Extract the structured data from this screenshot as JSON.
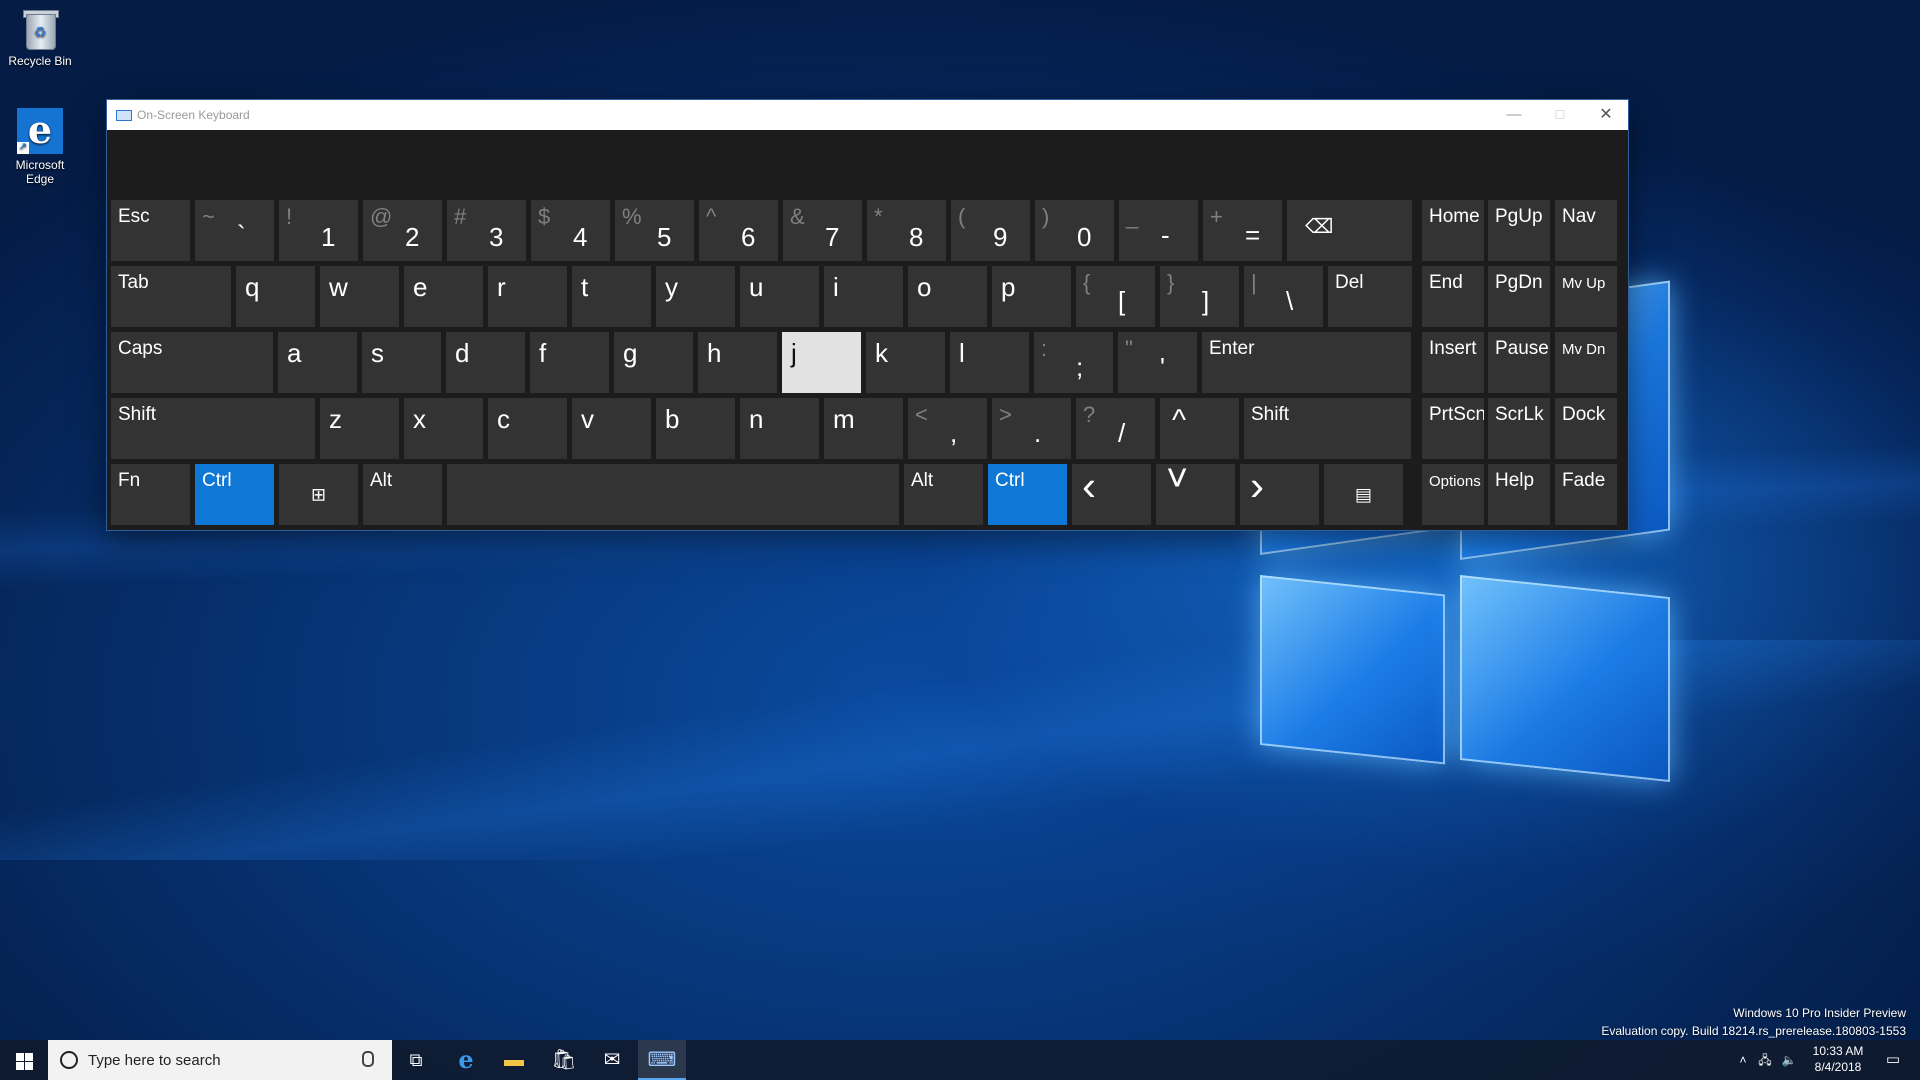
{
  "desktop": {
    "icons": [
      {
        "label": "Recycle Bin"
      },
      {
        "label": "Microsoft Edge"
      }
    ],
    "watermark": {
      "line1": "Windows 10 Pro Insider Preview",
      "line2": "Evaluation copy. Build 18214.rs_prerelease.180803-1553"
    }
  },
  "osk": {
    "title": "On-Screen Keyboard",
    "pressed_key": "j",
    "active_modifiers": [
      "Ctrl"
    ],
    "rows": [
      [
        {
          "label": "Esc"
        },
        {
          "secondary": "~",
          "primary": "`"
        },
        {
          "secondary": "!",
          "primary": "1"
        },
        {
          "secondary": "@",
          "primary": "2"
        },
        {
          "secondary": "#",
          "primary": "3"
        },
        {
          "secondary": "$",
          "primary": "4"
        },
        {
          "secondary": "%",
          "primary": "5"
        },
        {
          "secondary": "^",
          "primary": "6"
        },
        {
          "secondary": "&",
          "primary": "7"
        },
        {
          "secondary": "*",
          "primary": "8"
        },
        {
          "secondary": "(",
          "primary": "9"
        },
        {
          "secondary": ")",
          "primary": "0"
        },
        {
          "secondary": "_",
          "primary": "-"
        },
        {
          "secondary": "+",
          "primary": "="
        },
        {
          "icon": "backspace-icon",
          "glyph": "⌫"
        },
        {
          "label": "Home"
        },
        {
          "label": "PgUp"
        },
        {
          "label": "Nav"
        }
      ],
      [
        {
          "label": "Tab"
        },
        {
          "primary": "q"
        },
        {
          "primary": "w"
        },
        {
          "primary": "e"
        },
        {
          "primary": "r"
        },
        {
          "primary": "t"
        },
        {
          "primary": "y"
        },
        {
          "primary": "u"
        },
        {
          "primary": "i"
        },
        {
          "primary": "o"
        },
        {
          "primary": "p"
        },
        {
          "secondary": "{",
          "primary": "["
        },
        {
          "secondary": "}",
          "primary": "]"
        },
        {
          "secondary": "|",
          "primary": "\\"
        },
        {
          "label": "Del"
        },
        {
          "label": "End"
        },
        {
          "label": "PgDn"
        },
        {
          "label": "Mv Up"
        }
      ],
      [
        {
          "label": "Caps"
        },
        {
          "primary": "a"
        },
        {
          "primary": "s"
        },
        {
          "primary": "d"
        },
        {
          "primary": "f"
        },
        {
          "primary": "g"
        },
        {
          "primary": "h"
        },
        {
          "primary": "j"
        },
        {
          "primary": "k"
        },
        {
          "primary": "l"
        },
        {
          "secondary": ":",
          "primary": ";"
        },
        {
          "secondary": "\"",
          "primary": "'"
        },
        {
          "label": "Enter"
        },
        {
          "label": "Insert"
        },
        {
          "label": "Pause"
        },
        {
          "label": "Mv Dn"
        }
      ],
      [
        {
          "label": "Shift"
        },
        {
          "primary": "z"
        },
        {
          "primary": "x"
        },
        {
          "primary": "c"
        },
        {
          "primary": "v"
        },
        {
          "primary": "b"
        },
        {
          "primary": "n"
        },
        {
          "primary": "m"
        },
        {
          "secondary": "<",
          "primary": ","
        },
        {
          "secondary": ">",
          "primary": "."
        },
        {
          "secondary": "?",
          "primary": "/"
        },
        {
          "icon": "arrow-up-icon",
          "glyph": "^"
        },
        {
          "label": "Shift"
        },
        {
          "label": "PrtScn"
        },
        {
          "label": "ScrLk"
        },
        {
          "label": "Dock"
        }
      ],
      [
        {
          "label": "Fn"
        },
        {
          "label": "Ctrl"
        },
        {
          "icon": "windows-key-icon",
          "glyph": "⊞"
        },
        {
          "label": "Alt"
        },
        {
          "label": ""
        },
        {
          "label": "Alt"
        },
        {
          "label": "Ctrl"
        },
        {
          "icon": "arrow-left-icon",
          "glyph": "‹"
        },
        {
          "icon": "arrow-down-icon",
          "glyph": "˅"
        },
        {
          "icon": "arrow-right-icon",
          "glyph": "›"
        },
        {
          "icon": "menu-key-icon",
          "glyph": "▤"
        },
        {
          "label": "Options"
        },
        {
          "label": "Help"
        },
        {
          "label": "Fade"
        }
      ]
    ]
  },
  "taskbar": {
    "search_placeholder": "Type here to search",
    "time": "10:33 AM",
    "date": "8/4/2018",
    "pinned": [
      "task-view",
      "edge",
      "file-explorer",
      "store",
      "mail",
      "on-screen-keyboard"
    ]
  }
}
